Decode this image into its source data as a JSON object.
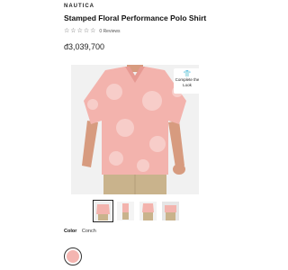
{
  "product": {
    "brand": "NAUTICA",
    "title": "Stamped Floral Performance Polo Shirt",
    "rating": {
      "stars": 0,
      "max_stars": 5,
      "reviews_text": "0 Reviews"
    },
    "price": "đ3,039,700"
  },
  "hero": {
    "complete_the_look_label": "Complete the Look",
    "complete_the_look_icon": "shirt-icon"
  },
  "thumbnails": {
    "count": 4,
    "selected_index": 0
  },
  "color": {
    "label": "Color",
    "value": "Conch",
    "swatch_hex": "#f4b5b1"
  },
  "colors": {
    "shirt": "#f3b3ad",
    "pants": "#c9b38c",
    "skin": "#d79b7f",
    "background": "#f1f1f1"
  }
}
